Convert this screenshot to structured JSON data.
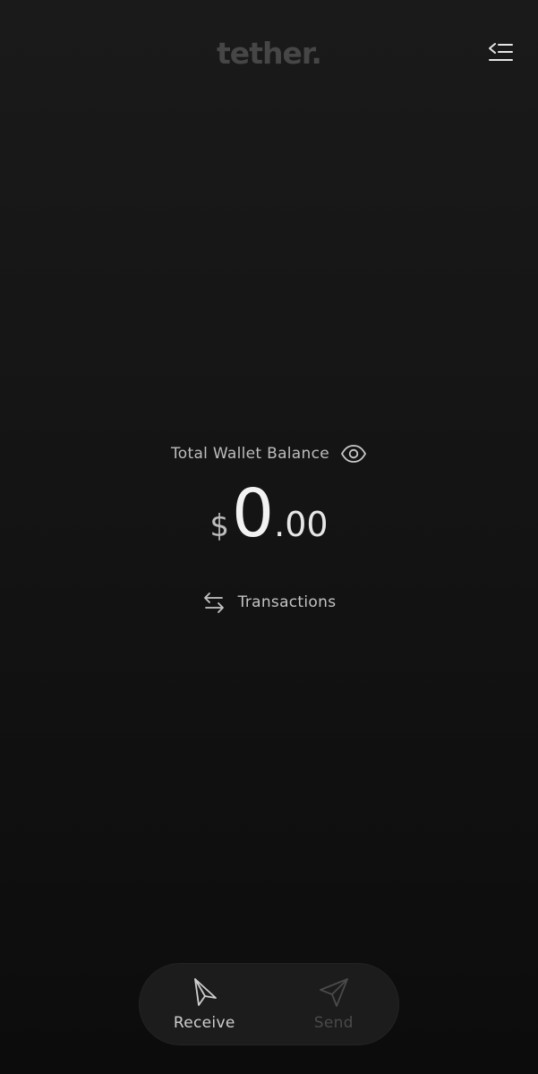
{
  "header": {
    "logo_text": "tether."
  },
  "balance": {
    "label": "Total Wallet Balance",
    "currency_symbol": "$",
    "amount_integer": "0",
    "amount_decimal": ".00"
  },
  "transactions": {
    "label": "Transactions"
  },
  "bottom_bar": {
    "receive_label": "Receive",
    "send_label": "Send"
  },
  "icons": {
    "menu": "menu-collapse-icon",
    "eye": "eye-icon",
    "transactions": "swap-arrows-icon",
    "receive": "receive-arrow-icon",
    "send": "send-paper-plane-icon"
  },
  "colors": {
    "background": "#141414",
    "logo": "#464646",
    "text_primary": "#f2f2f2",
    "text_secondary": "#bdbdbd",
    "inactive": "#4a4a4a",
    "bar_background": "#1c1c1c"
  }
}
